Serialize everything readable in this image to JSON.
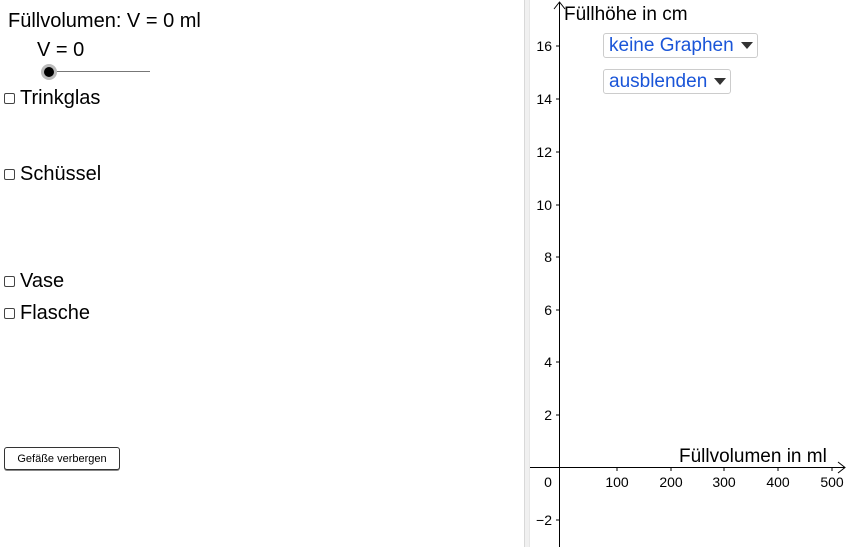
{
  "left": {
    "title": "Füllvolumen: V = 0 ml",
    "slider_label": "V = 0",
    "slider_value": 0,
    "checkboxes": [
      {
        "label": "Trinkglas",
        "checked": false
      },
      {
        "label": "Schüssel",
        "checked": false
      },
      {
        "label": "Vase",
        "checked": false
      },
      {
        "label": "Flasche",
        "checked": false
      }
    ],
    "button_label": "Gefäße verbergen"
  },
  "graph": {
    "y_axis_title": "Füllhöhe in cm",
    "x_axis_title": "Füllvolumen in ml",
    "dropdown1": "keine Graphen",
    "dropdown2": "ausblenden",
    "y_ticks": [
      "16",
      "14",
      "12",
      "10",
      "8",
      "6",
      "4",
      "2",
      "−2"
    ],
    "x_ticks": [
      "100",
      "200",
      "300",
      "400",
      "500"
    ],
    "origin_label": "0",
    "link_color": "#1a55d8"
  }
}
